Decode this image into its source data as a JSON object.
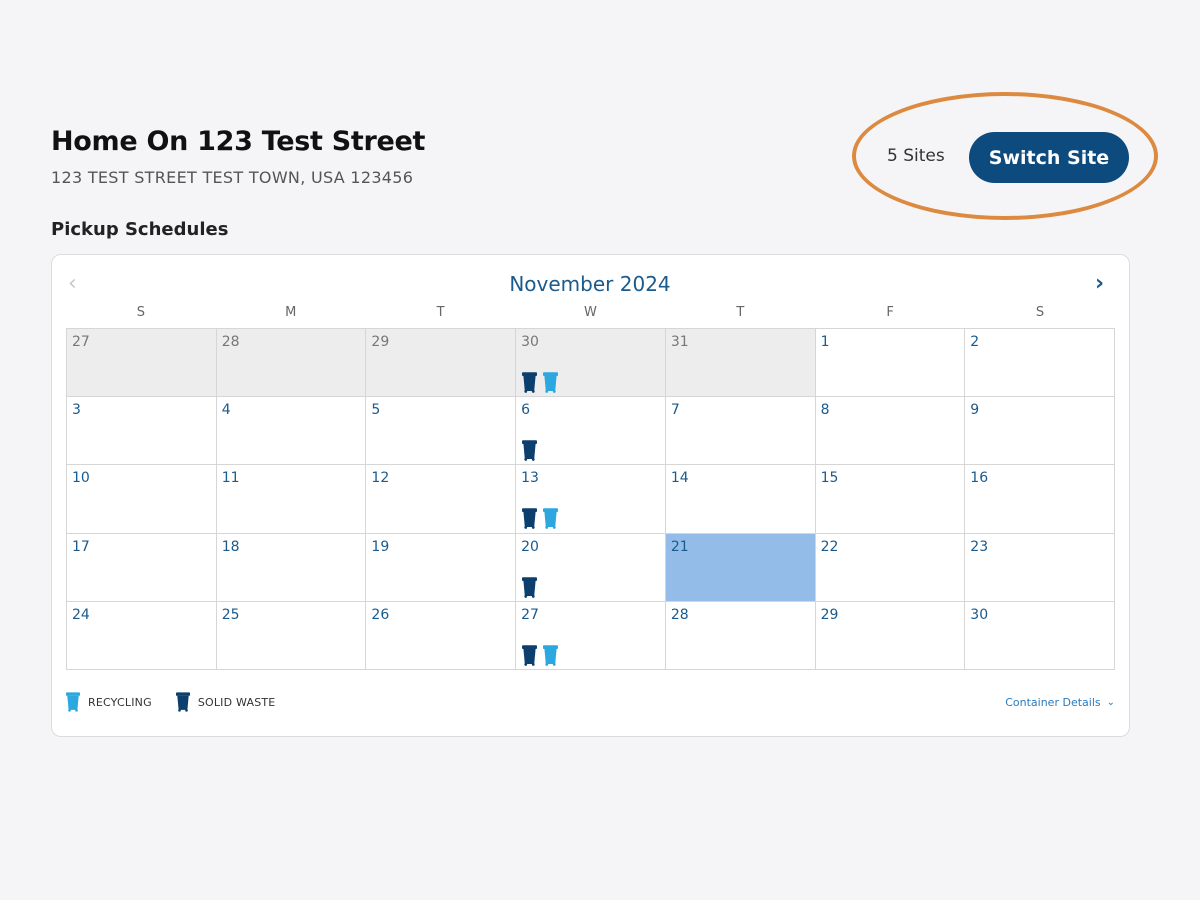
{
  "site": {
    "title": "Home On 123 Test Street",
    "address": "123 TEST STREET TEST TOWN, USA 123456",
    "sites_count": "5 Sites",
    "switch_label": "Switch Site"
  },
  "section_title": "Pickup Schedules",
  "calendar": {
    "month_label": "November 2024",
    "prev_icon": "chevron-left-icon",
    "next_icon": "chevron-right-icon",
    "weekdays": [
      "S",
      "M",
      "T",
      "W",
      "T",
      "F",
      "S"
    ],
    "today": 21,
    "weeks": [
      [
        {
          "day": "27",
          "other": true,
          "bins": []
        },
        {
          "day": "28",
          "other": true,
          "bins": []
        },
        {
          "day": "29",
          "other": true,
          "bins": []
        },
        {
          "day": "30",
          "other": true,
          "bins": [
            "solid",
            "recycle"
          ]
        },
        {
          "day": "31",
          "other": true,
          "bins": []
        },
        {
          "day": "1",
          "other": false,
          "bins": []
        },
        {
          "day": "2",
          "other": false,
          "bins": []
        }
      ],
      [
        {
          "day": "3",
          "other": false,
          "bins": []
        },
        {
          "day": "4",
          "other": false,
          "bins": []
        },
        {
          "day": "5",
          "other": false,
          "bins": []
        },
        {
          "day": "6",
          "other": false,
          "bins": [
            "solid"
          ]
        },
        {
          "day": "7",
          "other": false,
          "bins": []
        },
        {
          "day": "8",
          "other": false,
          "bins": []
        },
        {
          "day": "9",
          "other": false,
          "bins": []
        }
      ],
      [
        {
          "day": "10",
          "other": false,
          "bins": []
        },
        {
          "day": "11",
          "other": false,
          "bins": []
        },
        {
          "day": "12",
          "other": false,
          "bins": []
        },
        {
          "day": "13",
          "other": false,
          "bins": [
            "solid",
            "recycle"
          ]
        },
        {
          "day": "14",
          "other": false,
          "bins": []
        },
        {
          "day": "15",
          "other": false,
          "bins": []
        },
        {
          "day": "16",
          "other": false,
          "bins": []
        }
      ],
      [
        {
          "day": "17",
          "other": false,
          "bins": []
        },
        {
          "day": "18",
          "other": false,
          "bins": []
        },
        {
          "day": "19",
          "other": false,
          "bins": []
        },
        {
          "day": "20",
          "other": false,
          "bins": [
            "solid"
          ]
        },
        {
          "day": "21",
          "other": false,
          "bins": [],
          "today": true
        },
        {
          "day": "22",
          "other": false,
          "bins": []
        },
        {
          "day": "23",
          "other": false,
          "bins": []
        }
      ],
      [
        {
          "day": "24",
          "other": false,
          "bins": []
        },
        {
          "day": "25",
          "other": false,
          "bins": []
        },
        {
          "day": "26",
          "other": false,
          "bins": []
        },
        {
          "day": "27",
          "other": false,
          "bins": [
            "solid",
            "recycle"
          ]
        },
        {
          "day": "28",
          "other": false,
          "bins": []
        },
        {
          "day": "29",
          "other": false,
          "bins": []
        },
        {
          "day": "30",
          "other": false,
          "bins": []
        }
      ]
    ]
  },
  "legend": {
    "recycling_label": "RECYCLING",
    "solid_waste_label": "SOLID WASTE",
    "container_details_label": "Container Details"
  },
  "colors": {
    "recycle": "#2ca7e0",
    "solid": "#0d3f6e",
    "accent": "#0d4a7e",
    "highlight_ring": "#dc8a3f",
    "today_fill": "#93bce8"
  }
}
